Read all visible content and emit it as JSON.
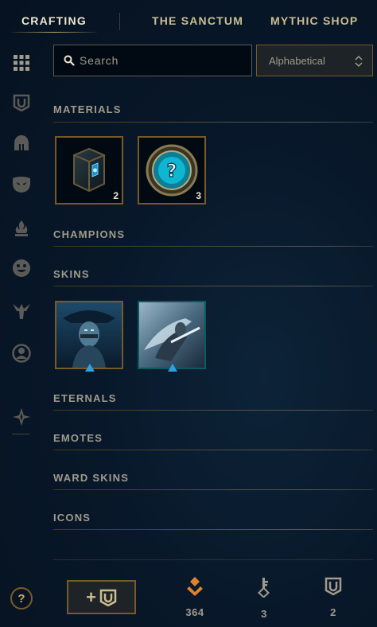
{
  "nav": {
    "tabs": [
      {
        "label": "CRAFTING",
        "active": true
      },
      {
        "label": "THE SANCTUM",
        "active": false
      },
      {
        "label": "MYTHIC SHOP",
        "active": false
      }
    ]
  },
  "sidebar": {
    "icons": [
      "grid-icon",
      "chest-icon",
      "helmet-icon",
      "mask-icon",
      "flame-icon",
      "emote-icon",
      "ward-icon",
      "profile-icon",
      "eternals-icon"
    ]
  },
  "search": {
    "placeholder": "Search",
    "value": ""
  },
  "sort": {
    "selected": "Alphabetical"
  },
  "sections": {
    "materials": "MATERIALS",
    "champions": "CHAMPIONS",
    "skins": "SKINS",
    "eternals": "ETERNALS",
    "emotes": "EMOTES",
    "ward_skins": "WARD SKINS",
    "icons": "ICONS"
  },
  "materials": [
    {
      "name": "hextech-chest",
      "count": "2"
    },
    {
      "name": "mystery-orb",
      "count": "3"
    }
  ],
  "skins": [
    {
      "name": "skin-shard-1"
    },
    {
      "name": "skin-shard-2"
    }
  ],
  "footer": {
    "help_label": "?",
    "add_label": "+",
    "orange_essence": "364",
    "keys": "3",
    "chests": "2"
  },
  "colors": {
    "gold": "#c8aa6e",
    "border_gold": "#785a28",
    "cyan": "#0ac8b9",
    "orange": "#e0822b"
  }
}
